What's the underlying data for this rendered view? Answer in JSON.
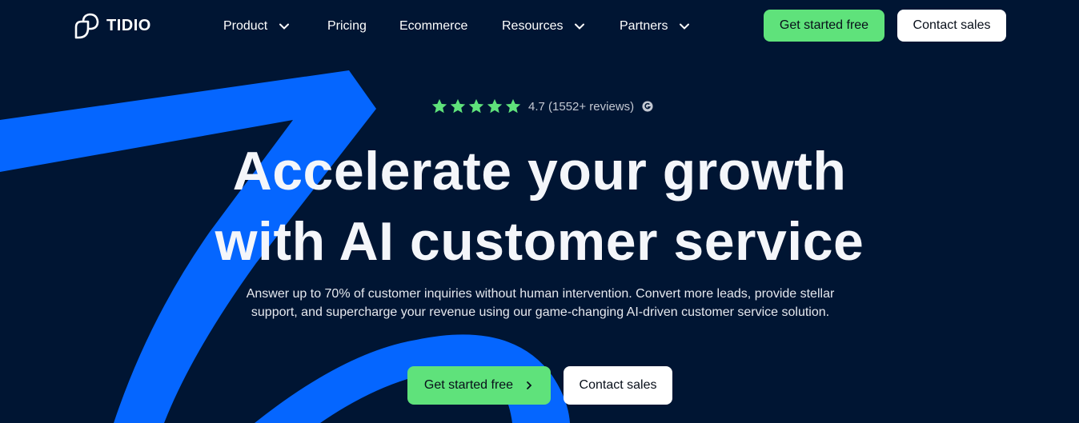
{
  "nav": {
    "logo_text": "TIDIO",
    "items": [
      {
        "label": "Product",
        "has_dropdown": true
      },
      {
        "label": "Pricing",
        "has_dropdown": false
      },
      {
        "label": "Ecommerce",
        "has_dropdown": false
      },
      {
        "label": "Resources",
        "has_dropdown": true
      },
      {
        "label": "Partners",
        "has_dropdown": true
      }
    ],
    "cta_primary": "Get started free",
    "cta_secondary": "Contact sales"
  },
  "hero": {
    "rating_stars": 5,
    "rating_text": "4.7 (1552+ reviews)",
    "headline_line1": "Accelerate your growth",
    "headline_line2": "with AI customer service",
    "subtext_line1": "Answer up to 70% of customer inquiries without human intervention. Convert more leads, provide stellar",
    "subtext_line2": "support, and supercharge your revenue using our game-changing AI-driven customer service solution.",
    "cta_primary": "Get started free",
    "cta_secondary": "Contact sales"
  },
  "colors": {
    "background": "#001533",
    "accent_blue": "#0566ff",
    "accent_green": "#5fe27b",
    "star_green": "#5fe27b"
  },
  "icons": [
    "tidio-logo-icon",
    "chevron-down-icon",
    "star-icon",
    "g2-icon",
    "chevron-right-icon"
  ]
}
